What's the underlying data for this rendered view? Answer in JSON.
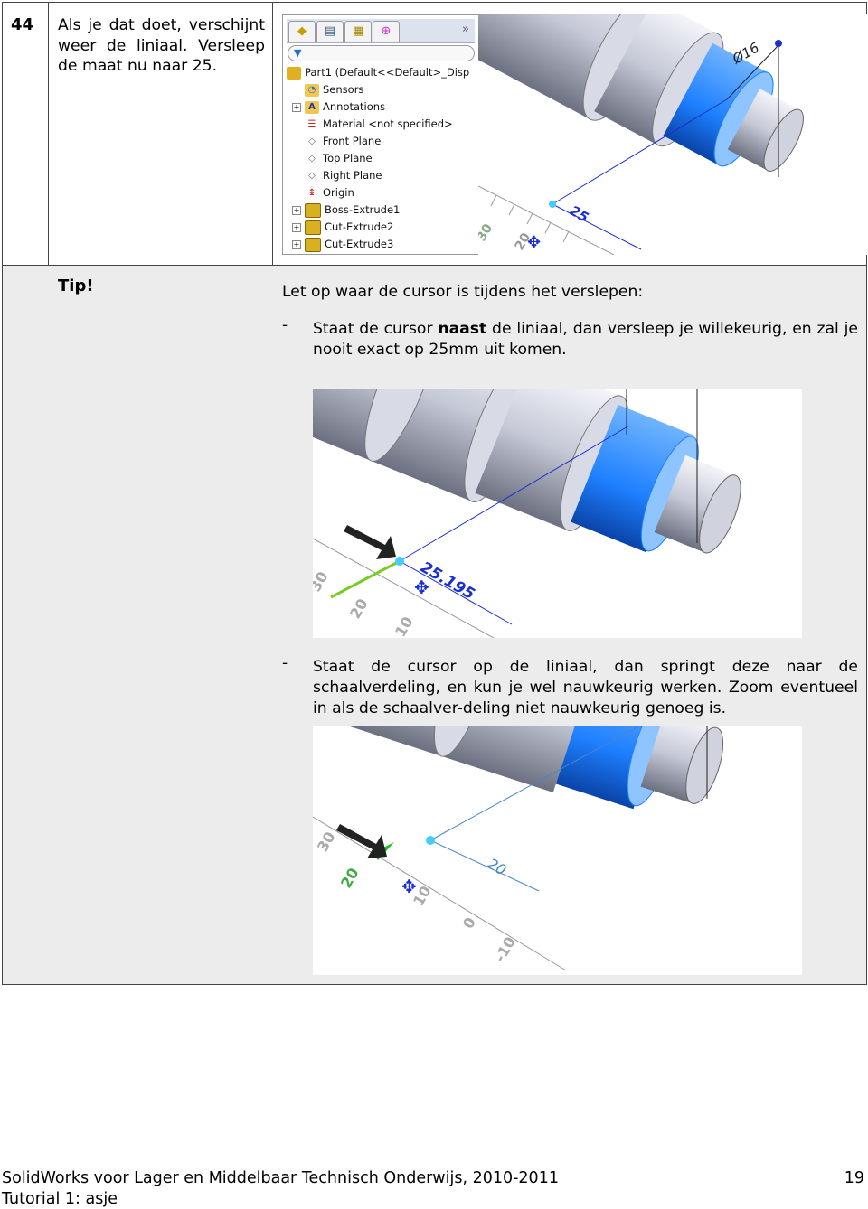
{
  "step": {
    "number": "44",
    "text": "Als je dat doet, verschijnt weer de liniaal. Versleep de maat nu naar 25."
  },
  "feature_tree": {
    "tabs": [
      "feature-manager-icon",
      "property-manager-icon",
      "configuration-manager-icon",
      "dimxpert-icon"
    ],
    "more": "»",
    "items": [
      {
        "label": "Part1  (Default<<Default>_Disp",
        "icon": "part-icon",
        "expandable": false
      },
      {
        "label": "Sensors",
        "icon": "sensors-folder-icon",
        "expandable": false
      },
      {
        "label": "Annotations",
        "icon": "annotations-folder-icon",
        "expandable": true
      },
      {
        "label": "Material <not specified>",
        "icon": "material-icon",
        "expandable": false
      },
      {
        "label": "Front Plane",
        "icon": "plane-icon",
        "expandable": false
      },
      {
        "label": "Top Plane",
        "icon": "plane-icon",
        "expandable": false
      },
      {
        "label": "Right Plane",
        "icon": "plane-icon",
        "expandable": false
      },
      {
        "label": "Origin",
        "icon": "origin-icon",
        "expandable": false
      },
      {
        "label": "Boss-Extrude1",
        "icon": "boss-extrude-icon",
        "expandable": true
      },
      {
        "label": "Cut-Extrude2",
        "icon": "cut-extrude-icon",
        "expandable": true
      },
      {
        "label": "Cut-Extrude3",
        "icon": "cut-extrude-icon",
        "expandable": true
      }
    ]
  },
  "cad_images": {
    "image1": {
      "diameter_label": "Ø16",
      "dimension_label": "25",
      "ruler_labels": [
        "30",
        "20"
      ]
    },
    "image2": {
      "dimension_label": "25.195",
      "ruler_labels": [
        "30",
        "20",
        "10"
      ]
    },
    "image3": {
      "dimension_label": "20",
      "ruler_labels": [
        "30",
        "20",
        "10",
        "0",
        "-10"
      ]
    }
  },
  "tip": {
    "label": "Tip!",
    "intro": "Let op waar de cursor is tijdens het verslepen:",
    "bullet_marker": "-",
    "bullet1_before": "Staat de cursor ",
    "bullet1_bold": "naast",
    "bullet1_after": " de liniaal, dan versleep je willekeurig, en zal je nooit exact op 25mm uit komen.",
    "bullet2": "Staat de cursor op de liniaal, dan springt deze naar de schaalverdeling, en kun je wel nauwkeurig werken. Zoom eventueel in als de schaalver-deling niet nauwkeurig genoeg is."
  },
  "footer": {
    "line1": "SolidWorks voor Lager en Middelbaar Technisch Onderwijs, 2010-2011",
    "line2": "Tutorial 1: asje",
    "page": "19"
  },
  "colors": {
    "tip_background": "#ececec",
    "highlight_blue": "#1e7fff",
    "dimension_blue": "#1a2fd0",
    "shaft_gray": "#c8ccd8"
  }
}
